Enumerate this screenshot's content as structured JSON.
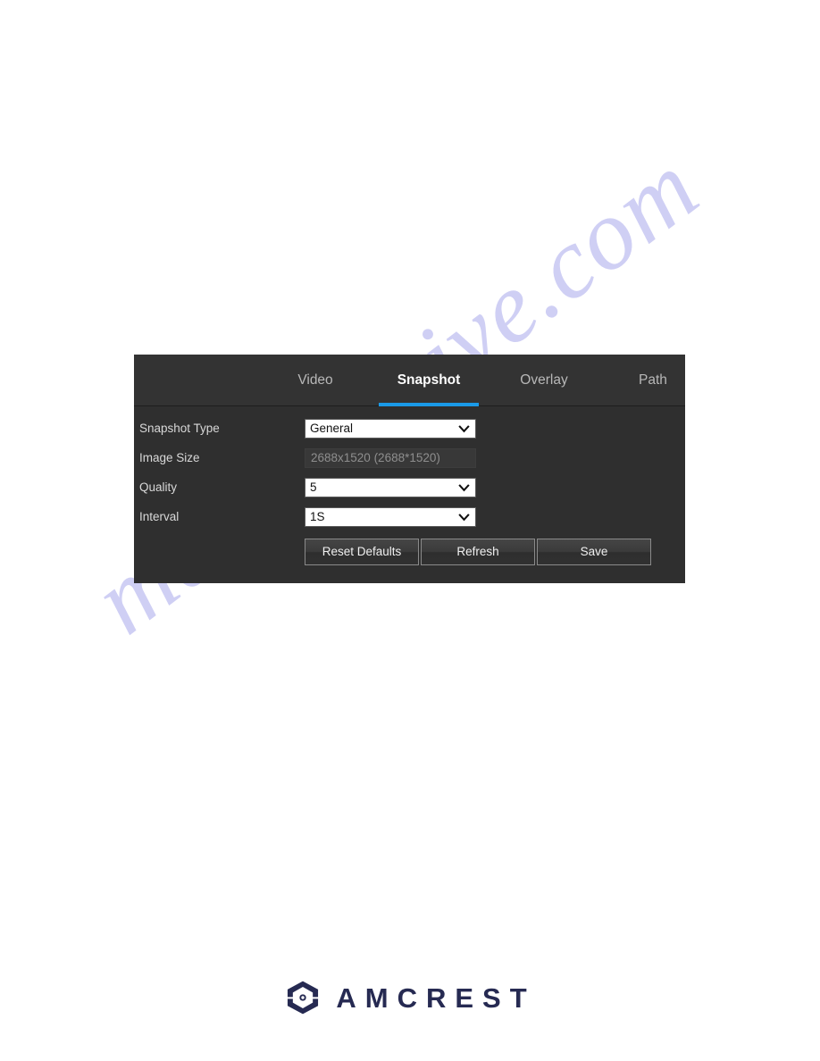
{
  "watermark": {
    "text": "manualshive.com",
    "color": "#bdbdf0"
  },
  "panel": {
    "accent_color": "#1a9ae8",
    "background_color": "#2f2f2f",
    "tabs": [
      {
        "id": "video",
        "label": "Video",
        "active": false
      },
      {
        "id": "snapshot",
        "label": "Snapshot",
        "active": true
      },
      {
        "id": "overlay",
        "label": "Overlay",
        "active": false
      },
      {
        "id": "path",
        "label": "Path",
        "active": false
      }
    ],
    "form": {
      "snapshot_type": {
        "label": "Snapshot Type",
        "value": "General",
        "control": "select",
        "icon": "chevron-down-icon"
      },
      "image_size": {
        "label": "Image Size",
        "value": "2688x1520 (2688*1520)",
        "control": "readonly-text"
      },
      "quality": {
        "label": "Quality",
        "value": "5",
        "control": "select",
        "icon": "chevron-down-icon"
      },
      "interval": {
        "label": "Interval",
        "value": "1S",
        "control": "select",
        "icon": "chevron-down-icon"
      }
    },
    "buttons": {
      "reset_defaults": "Reset Defaults",
      "refresh": "Refresh",
      "save": "Save"
    }
  },
  "footer": {
    "brand": "AMCREST",
    "logo_icon": "amcrest-hexagon-logo-icon",
    "brand_color": "#262a52",
    "logo_accent_color": "#2f80c8"
  }
}
